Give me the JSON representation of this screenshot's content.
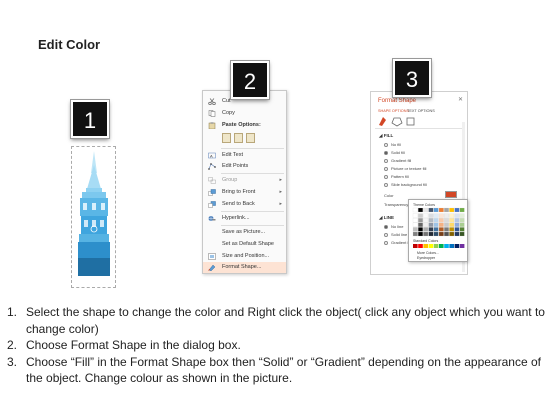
{
  "title": "Edit Color",
  "steps": [
    "1",
    "2",
    "3"
  ],
  "context_menu": {
    "items": [
      {
        "label": "Cut",
        "icon": "scissors-icon"
      },
      {
        "label": "Copy",
        "icon": "copy-icon"
      },
      {
        "label": "Paste Options:",
        "icon": "paste-icon"
      },
      {
        "label": "Edit Text",
        "icon": "edit-text-icon"
      },
      {
        "label": "Edit Points",
        "icon": "edit-points-icon"
      },
      {
        "label": "Group",
        "icon": "group-icon",
        "submenu": true,
        "disabled": true
      },
      {
        "label": "Bring to Front",
        "icon": "bring-front-icon",
        "submenu": true
      },
      {
        "label": "Send to Back",
        "icon": "send-back-icon",
        "submenu": true
      },
      {
        "label": "Hyperlink...",
        "icon": "hyperlink-icon"
      },
      {
        "label": "Save as Picture...",
        "icon": ""
      },
      {
        "label": "Set as Default Shape",
        "icon": ""
      },
      {
        "label": "Size and Position...",
        "icon": "size-position-icon"
      },
      {
        "label": "Format Shape...",
        "icon": "format-shape-icon",
        "highlighted": true
      }
    ]
  },
  "format_shape": {
    "title": "Format Shape",
    "tabs": [
      "SHAPE OPTIONS",
      "TEXT OPTIONS"
    ],
    "fill_header": "FILL",
    "fill_options": [
      "No fill",
      "Solid fill",
      "Gradient fill",
      "Picture or texture fill",
      "Pattern fill",
      "Slide background fill"
    ],
    "color_label": "Color",
    "transparency_label": "Transparency",
    "line_header": "LINE",
    "line_options": [
      "No line",
      "Solid line",
      "Gradient line"
    ],
    "accent_color": "#d24726"
  },
  "color_popup": {
    "theme_colors_label": "Theme Colors",
    "standard_colors_label": "Standard Colors",
    "more_colors": "More Colors...",
    "eyedropper": "Eyedropper"
  },
  "instructions": [
    {
      "num": "1.",
      "text": "Select the shape to change the color and Right click the object( click any object which you want to change color)"
    },
    {
      "num": "2.",
      "text": "Choose Format Shape in the dialog box."
    },
    {
      "num": "3.",
      "text": "Choose “Fill” in the Format Shape box then “Solid” or “Gradient” depending on the appearance of the object. Change colour as shown in the picture."
    }
  ]
}
